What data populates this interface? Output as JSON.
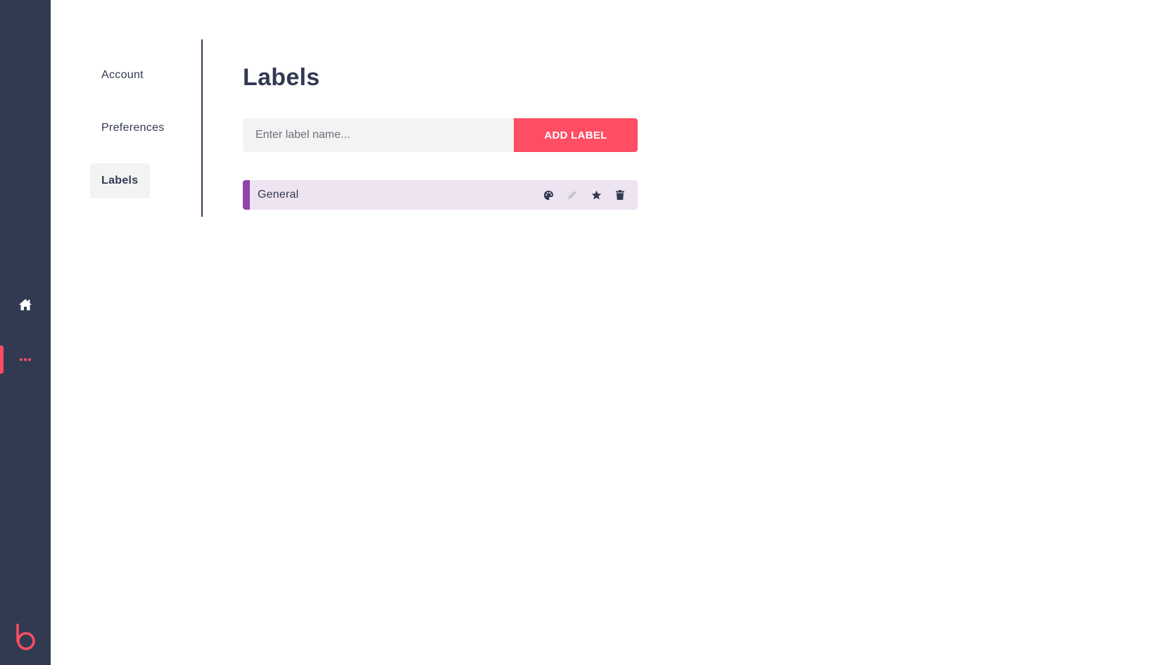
{
  "rail": {
    "items": [
      {
        "id": "home",
        "icon": "home-icon"
      },
      {
        "id": "more",
        "icon": "more-dots-icon",
        "active": true
      }
    ],
    "logo": "b-logo",
    "colors": {
      "background": "#323a52",
      "accent": "#ff4d63"
    }
  },
  "settings_nav": {
    "items": [
      {
        "label": "Account",
        "active": false
      },
      {
        "label": "Preferences",
        "active": false
      },
      {
        "label": "Labels",
        "active": true
      }
    ]
  },
  "main": {
    "title": "Labels",
    "input": {
      "placeholder": "Enter label name...",
      "value": ""
    },
    "add_button_label": "ADD LABEL",
    "labels": [
      {
        "name": "General",
        "color": "#8e44ad",
        "actions": [
          "palette-icon",
          "pencil-icon",
          "star-icon",
          "trash-icon"
        ]
      }
    ]
  }
}
